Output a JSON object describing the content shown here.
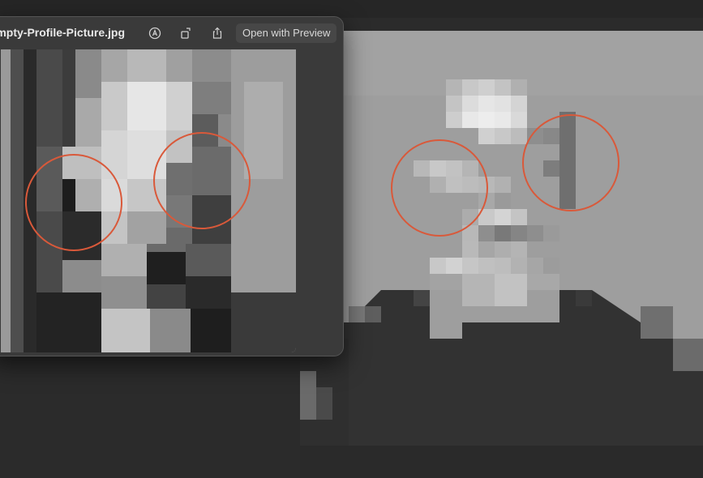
{
  "window": {
    "title": "Empty-Profile-Picture.jpg",
    "open_with_label": "Open with Preview"
  },
  "toolbar_icons": [
    "markup-icon",
    "rotate-icon",
    "share-icon"
  ],
  "colors": {
    "annotation_circle": "#d9593a",
    "window_bg": "#3a3a3a",
    "desktop_bg": "#2b2b2b"
  }
}
